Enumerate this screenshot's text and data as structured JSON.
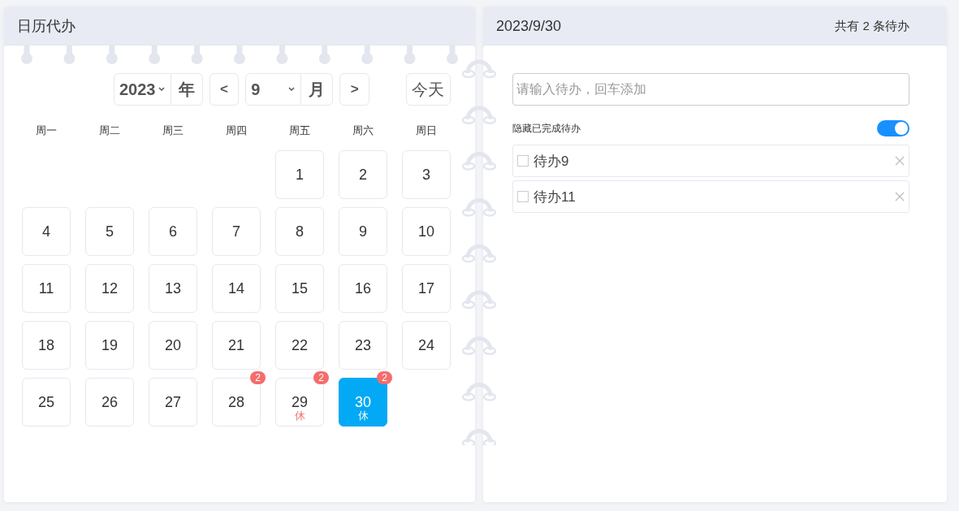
{
  "calendar_panel": {
    "title": "日历代办",
    "year": "2023",
    "year_unit": "年",
    "prev": "<",
    "month": "9",
    "month_unit": "月",
    "next": ">",
    "today": "今天",
    "weekdays": [
      "周一",
      "周二",
      "周三",
      "周四",
      "周五",
      "周六",
      "周日"
    ],
    "days": [
      {
        "day": "1",
        "selected": false
      },
      {
        "day": "2",
        "selected": false
      },
      {
        "day": "3",
        "selected": false
      },
      {
        "day": "4",
        "selected": false
      },
      {
        "day": "5",
        "selected": false
      },
      {
        "day": "6",
        "selected": false
      },
      {
        "day": "7",
        "selected": false
      },
      {
        "day": "8",
        "selected": false
      },
      {
        "day": "9",
        "selected": false
      },
      {
        "day": "10",
        "selected": false
      },
      {
        "day": "11",
        "selected": false
      },
      {
        "day": "12",
        "selected": false
      },
      {
        "day": "13",
        "selected": false
      },
      {
        "day": "14",
        "selected": false
      },
      {
        "day": "15",
        "selected": false
      },
      {
        "day": "16",
        "selected": false
      },
      {
        "day": "17",
        "selected": false
      },
      {
        "day": "18",
        "selected": false
      },
      {
        "day": "19",
        "selected": false
      },
      {
        "day": "20",
        "selected": false
      },
      {
        "day": "21",
        "selected": false
      },
      {
        "day": "22",
        "selected": false
      },
      {
        "day": "23",
        "selected": false
      },
      {
        "day": "24",
        "selected": false
      },
      {
        "day": "25",
        "selected": false
      },
      {
        "day": "26",
        "selected": false
      },
      {
        "day": "27",
        "selected": false
      },
      {
        "day": "28",
        "selected": false,
        "count": "2"
      },
      {
        "day": "29",
        "selected": false,
        "count": "2",
        "note": "休"
      },
      {
        "day": "30",
        "selected": true,
        "count": "2",
        "note": "休"
      }
    ]
  },
  "todo_panel": {
    "date": "2023/9/30",
    "summary": "共有 2 条待办",
    "input": {
      "placeholder": "请输入待办，回车添加"
    },
    "hide_done": {
      "label": "隐藏已完成待办",
      "on": true
    },
    "todos": [
      {
        "text": "待办9",
        "checked": false
      },
      {
        "text": "待办11",
        "checked": false
      }
    ]
  }
}
